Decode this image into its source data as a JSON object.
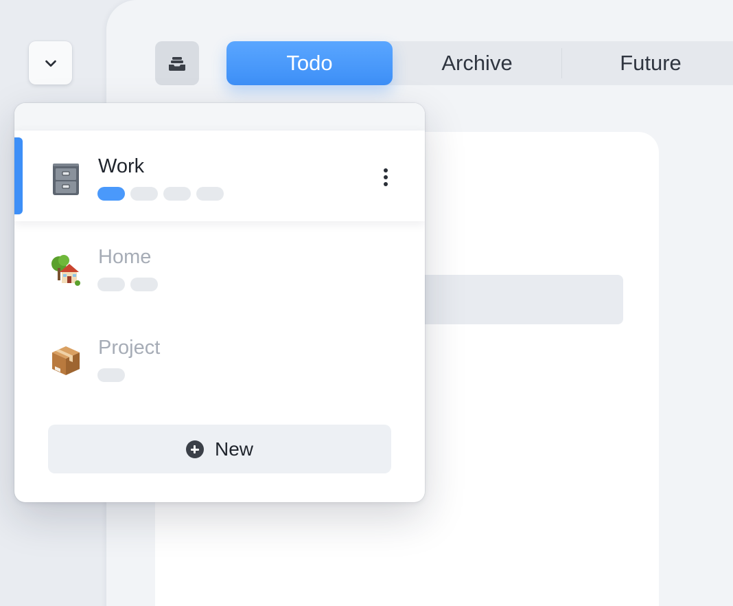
{
  "colors": {
    "accent": "#3d8ff7",
    "background": "#e9ecf1",
    "window": "#f2f4f7",
    "muted_text": "#a6acb6"
  },
  "toolbar": {
    "collapse_icon": "chevron-down-icon",
    "inbox_icon": "inbox-tray-icon"
  },
  "tabs": [
    {
      "label": "Todo",
      "active": true
    },
    {
      "label": "Archive",
      "active": false
    },
    {
      "label": "Future",
      "active": false
    }
  ],
  "dropdown": {
    "items": [
      {
        "label": "Work",
        "icon": "file-cabinet-icon",
        "selected": true,
        "pills": 4,
        "active_pill": 1
      },
      {
        "label": "Home",
        "icon": "house-with-tree-icon",
        "selected": false,
        "pills": 2,
        "active_pill": 0
      },
      {
        "label": "Project",
        "icon": "package-icon",
        "selected": false,
        "pills": 1,
        "active_pill": 0
      }
    ],
    "new_label": "New",
    "new_icon": "plus-circle-icon",
    "more_icon": "more-vertical-icon"
  }
}
